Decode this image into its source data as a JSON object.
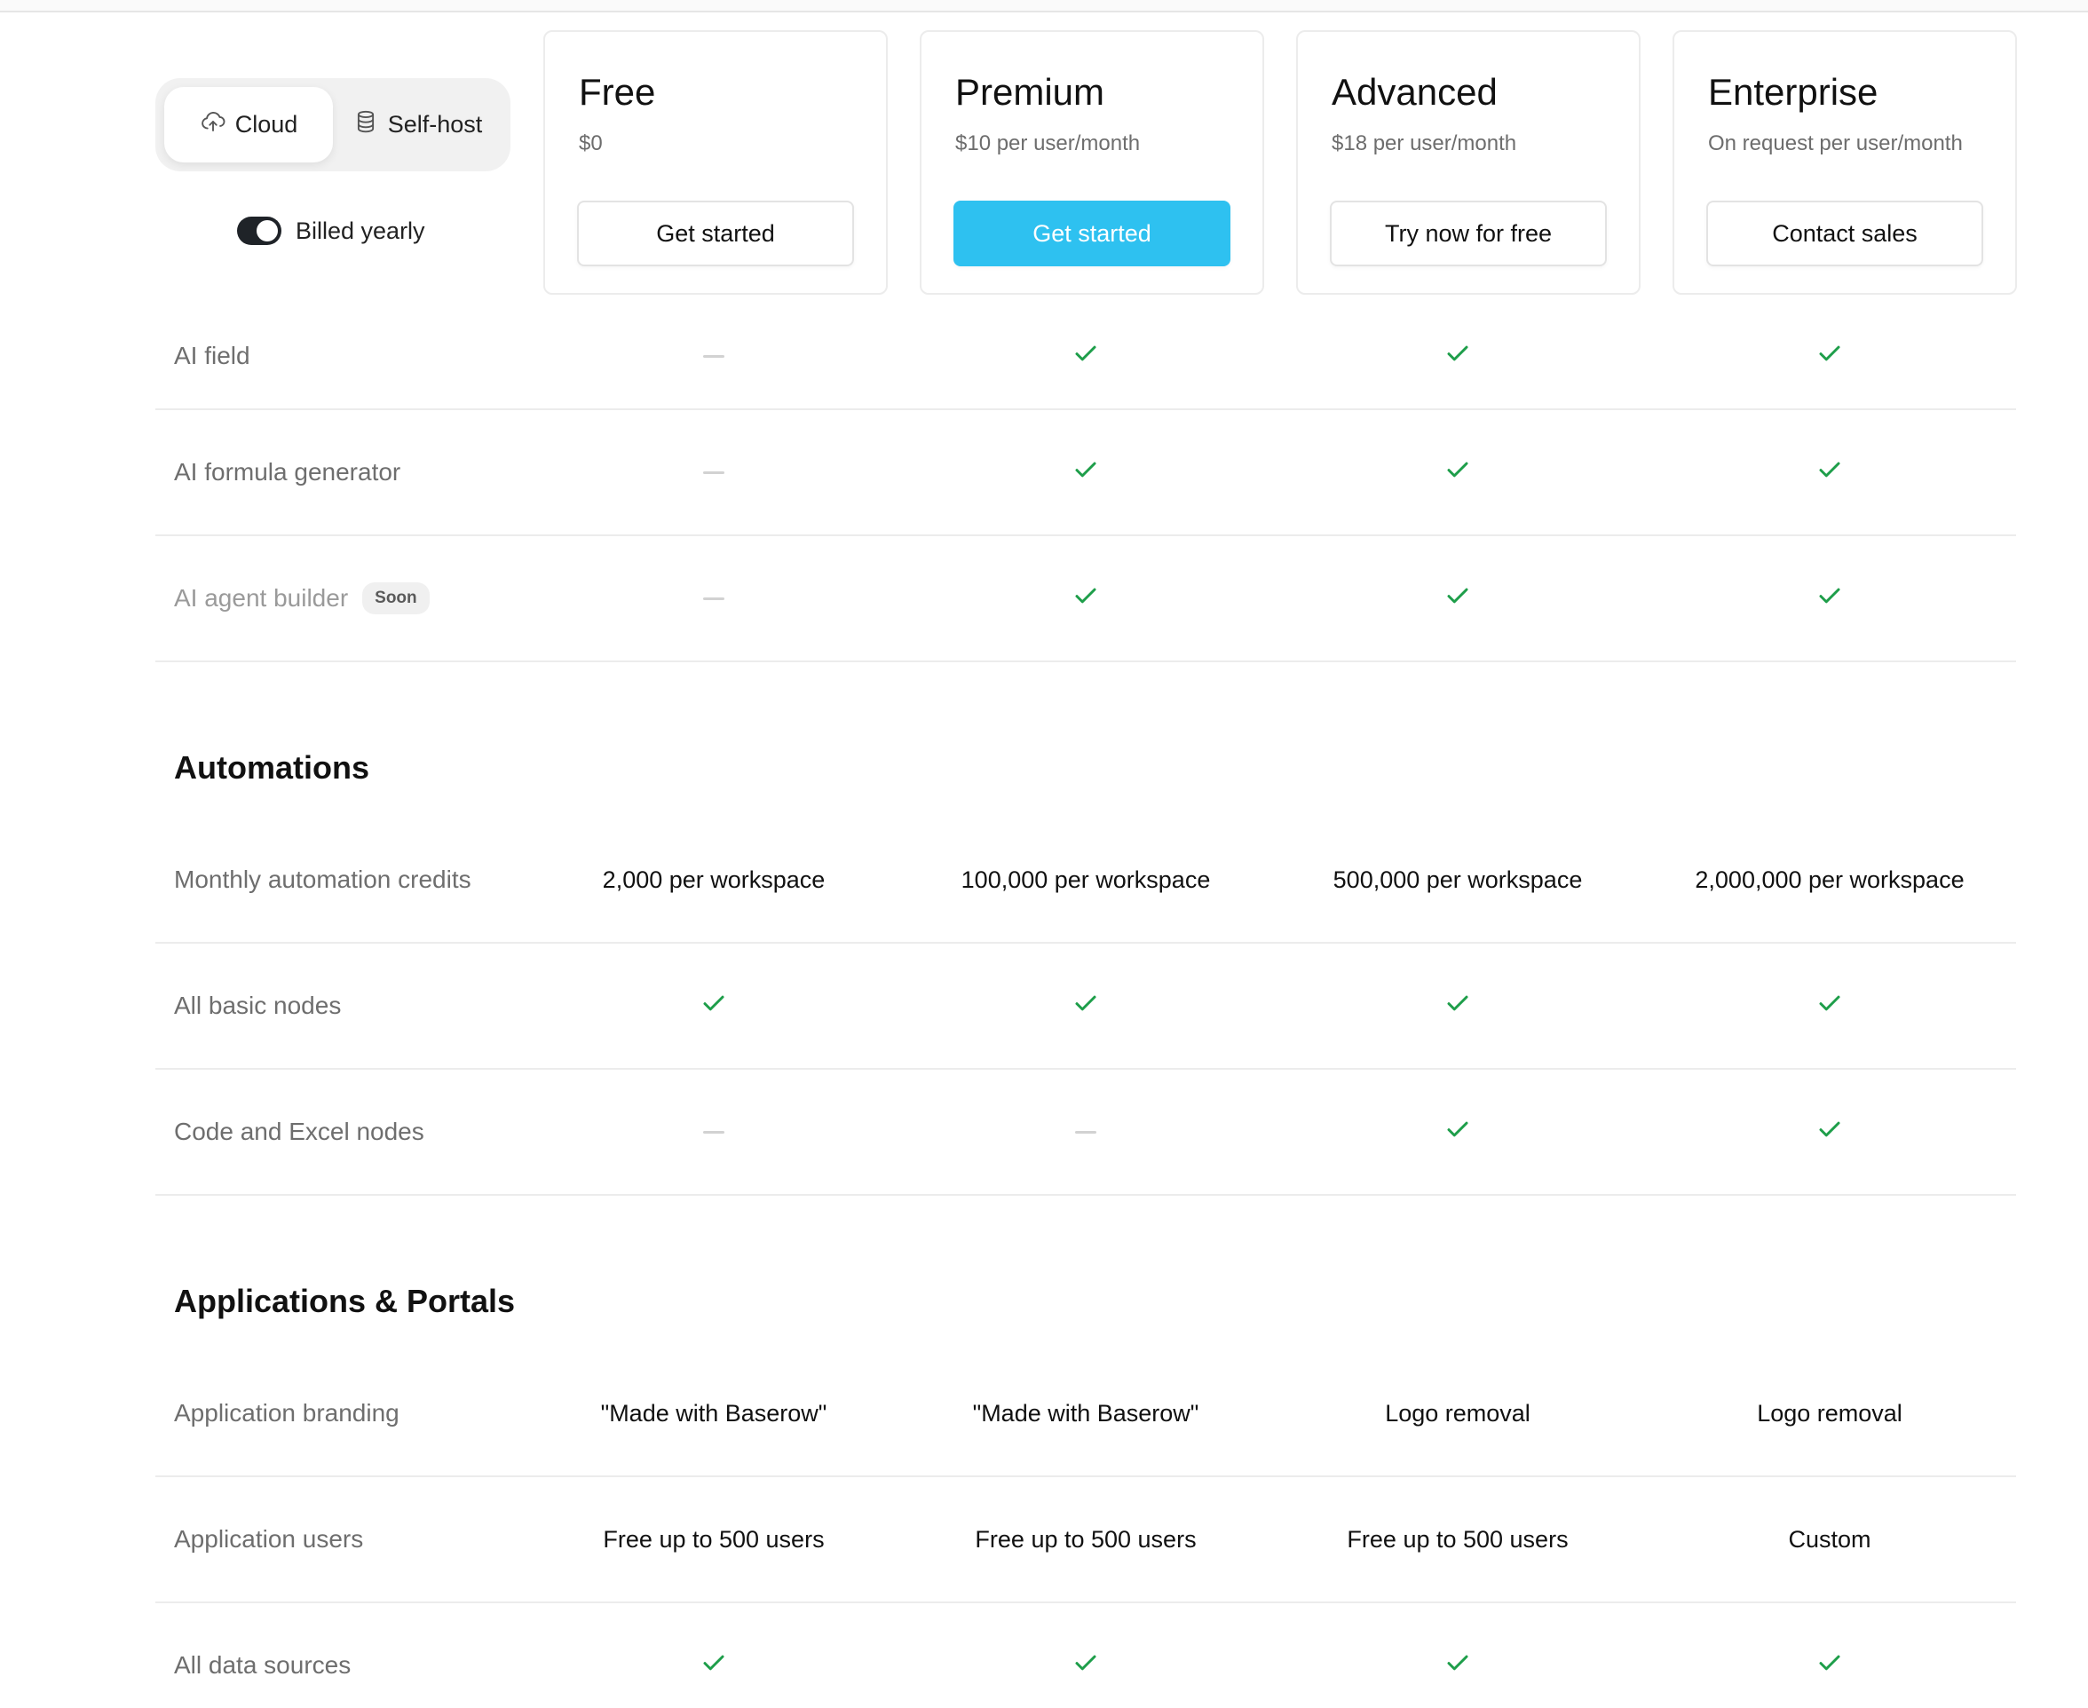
{
  "deployment": {
    "options": [
      {
        "label": "Cloud",
        "icon": "cloud-upload-icon",
        "active": true
      },
      {
        "label": "Self-host",
        "icon": "database-icon",
        "active": false
      }
    ]
  },
  "billing": {
    "label": "Billed yearly",
    "enabled": true
  },
  "plans": [
    {
      "name": "Free",
      "price": "$0",
      "cta": "Get started",
      "primary": false
    },
    {
      "name": "Premium",
      "price": "$10 per user/month",
      "cta": "Get started",
      "primary": true
    },
    {
      "name": "Advanced",
      "price": "$18 per user/month",
      "cta": "Try now for free",
      "primary": false
    },
    {
      "name": "Enterprise",
      "price": "On request per user/month",
      "cta": "Contact sales",
      "primary": false
    }
  ],
  "colors": {
    "accent": "#2ec1f0",
    "check": "#1e9e4a",
    "dash": "#d2d2d2"
  },
  "groups": [
    {
      "title": "",
      "rows": [
        {
          "feature": "AI field",
          "values": [
            "dash",
            "check",
            "check",
            "check"
          ]
        },
        {
          "feature": "AI formula generator",
          "values": [
            "dash",
            "check",
            "check",
            "check"
          ]
        },
        {
          "feature": "AI agent builder",
          "badge": "Soon",
          "muted": true,
          "values": [
            "dash",
            "check",
            "check",
            "check"
          ]
        }
      ]
    },
    {
      "title": "Automations",
      "rows": [
        {
          "feature": "Monthly automation credits",
          "values": [
            "2,000 per workspace",
            "100,000 per workspace",
            "500,000 per workspace",
            "2,000,000 per workspace"
          ]
        },
        {
          "feature": "All basic nodes",
          "values": [
            "check",
            "check",
            "check",
            "check"
          ]
        },
        {
          "feature": "Code and Excel nodes",
          "values": [
            "dash",
            "dash",
            "check",
            "check"
          ]
        }
      ]
    },
    {
      "title": "Applications & Portals",
      "rows": [
        {
          "feature": "Application branding",
          "values": [
            "\"Made with Baserow\"",
            "\"Made with Baserow\"",
            "Logo removal",
            "Logo removal"
          ]
        },
        {
          "feature": "Application users",
          "values": [
            "Free up to 500 users",
            "Free up to 500 users",
            "Free up to 500 users",
            "Custom"
          ]
        },
        {
          "feature": "All data sources",
          "values": [
            "check",
            "check",
            "check",
            "check"
          ]
        }
      ]
    }
  ]
}
